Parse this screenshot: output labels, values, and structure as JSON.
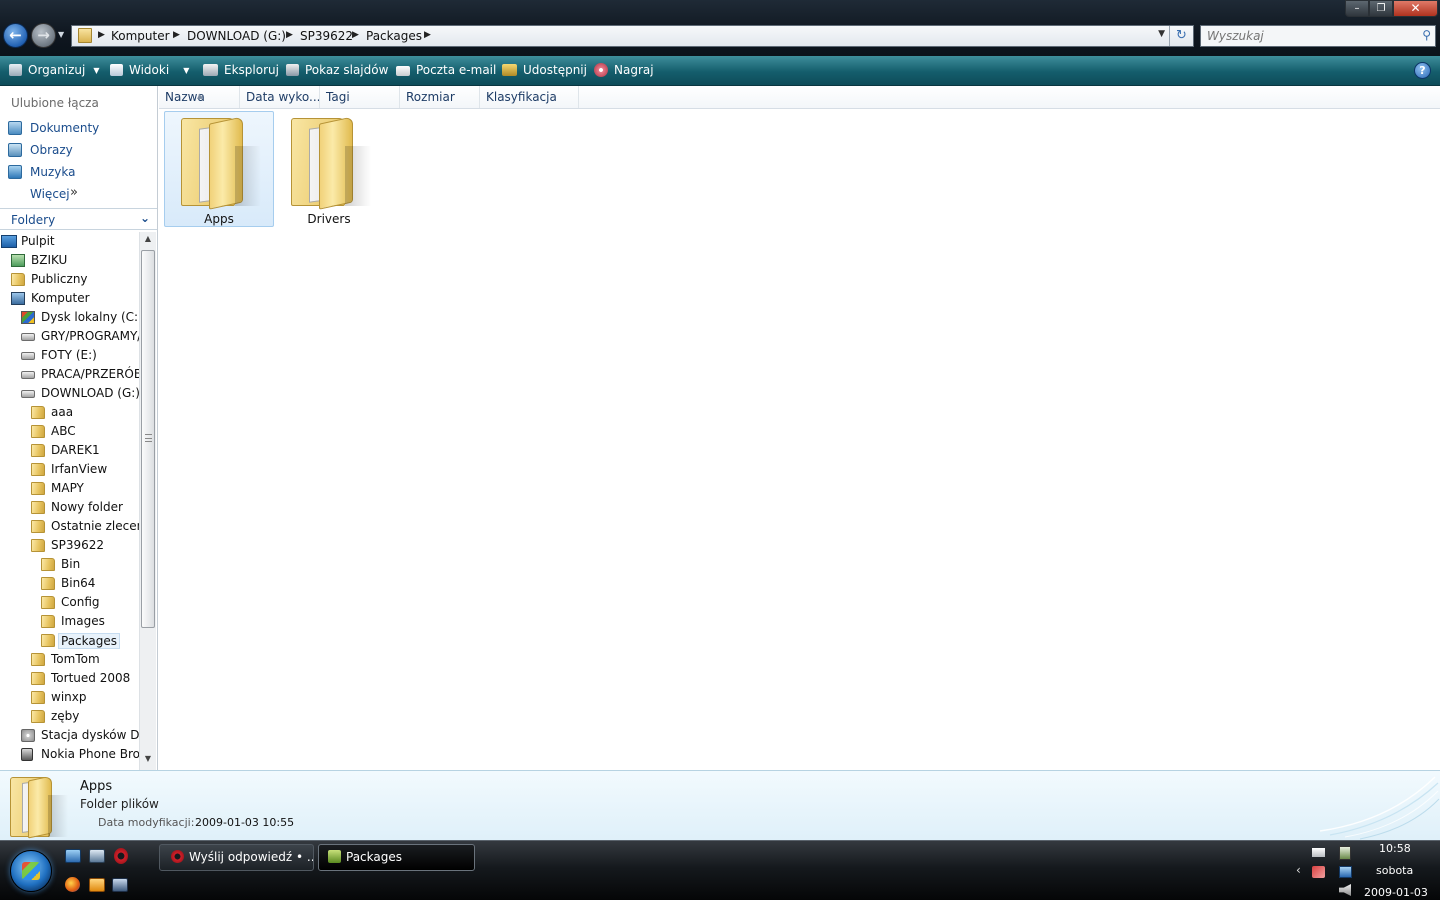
{
  "window": {
    "minimize_label": "–",
    "maximize_label": "❐",
    "close_label": "✕"
  },
  "address": {
    "breadcrumbs": [
      "Komputer",
      "DOWNLOAD (G:)",
      "SP39622",
      "Packages"
    ]
  },
  "search": {
    "placeholder": "Wyszukaj"
  },
  "commandbar": {
    "organize": "Organizuj",
    "views": "Widoki",
    "explore": "Eksploruj",
    "slideshow": "Pokaz slajdów",
    "email": "Poczta e-mail",
    "share": "Udostępnij",
    "burn": "Nagraj",
    "help": "?"
  },
  "favorites": {
    "title": "Ulubione łącza",
    "items": [
      "Dokumenty",
      "Obrazy",
      "Muzyka",
      "Więcej"
    ],
    "more_arrow": "»"
  },
  "folders": {
    "label": "Foldery",
    "tree": [
      {
        "label": "Pulpit",
        "icon": "desktop-icon"
      },
      {
        "label": "BZIKU",
        "icon": "user-icon"
      },
      {
        "label": "Publiczny",
        "icon": "folder-icon"
      },
      {
        "label": "Komputer",
        "icon": "computer-icon"
      },
      {
        "label": "Dysk lokalny (C:)",
        "icon": "windows-drive-icon"
      },
      {
        "label": "GRY/PROGRAMY/(",
        "icon": "drive-icon"
      },
      {
        "label": "FOTY (E:)",
        "icon": "drive-icon"
      },
      {
        "label": "PRACA/PRZERÓBK",
        "icon": "drive-icon"
      },
      {
        "label": "DOWNLOAD (G:)",
        "icon": "drive-icon"
      },
      {
        "label": "aaa",
        "icon": "folder-icon"
      },
      {
        "label": "ABC",
        "icon": "folder-icon"
      },
      {
        "label": "DAREK1",
        "icon": "folder-icon"
      },
      {
        "label": "IrfanView",
        "icon": "folder-icon"
      },
      {
        "label": "MAPY",
        "icon": "folder-icon"
      },
      {
        "label": "Nowy folder",
        "icon": "folder-icon"
      },
      {
        "label": "Ostatnie zlecenie",
        "icon": "folder-icon"
      },
      {
        "label": "SP39622",
        "icon": "folder-icon"
      },
      {
        "label": "Bin",
        "icon": "folder-icon"
      },
      {
        "label": "Bin64",
        "icon": "folder-icon"
      },
      {
        "label": "Config",
        "icon": "folder-icon"
      },
      {
        "label": "Images",
        "icon": "folder-icon"
      },
      {
        "label": "Packages",
        "icon": "folder-icon"
      },
      {
        "label": "TomTom",
        "icon": "folder-icon"
      },
      {
        "label": "Tortued 2008",
        "icon": "folder-icon"
      },
      {
        "label": "winxp",
        "icon": "folder-icon"
      },
      {
        "label": "zęby",
        "icon": "folder-icon"
      },
      {
        "label": "Stacja dysków DVD",
        "icon": "dvd-drive-icon"
      },
      {
        "label": "Nokia Phone Brow",
        "icon": "phone-icon"
      }
    ],
    "selected": "Packages"
  },
  "columns": [
    "Nazwa",
    "Data wyko...",
    "Tagi",
    "Rozmiar",
    "Klasyfikacja"
  ],
  "items": [
    {
      "name": "Apps",
      "selected": true
    },
    {
      "name": "Drivers",
      "selected": false
    }
  ],
  "details": {
    "name": "Apps",
    "type": "Folder plików",
    "modified_label": "Data modyfikacji:",
    "modified_value": "2009-01-03 10:55"
  },
  "taskbar": {
    "tasks": [
      {
        "label": "Wyślij odpowiedź • ...",
        "icon": "opera-icon",
        "active": false
      },
      {
        "label": "Packages",
        "icon": "folder-icon",
        "active": true
      }
    ],
    "clock": {
      "time": "10:58",
      "day": "sobota",
      "date": "2009-01-03"
    }
  },
  "colors": {
    "commandbar": "#145d6c",
    "link": "#1a4c8c",
    "selection": "#d8eafa",
    "folder": "#e8c561"
  }
}
